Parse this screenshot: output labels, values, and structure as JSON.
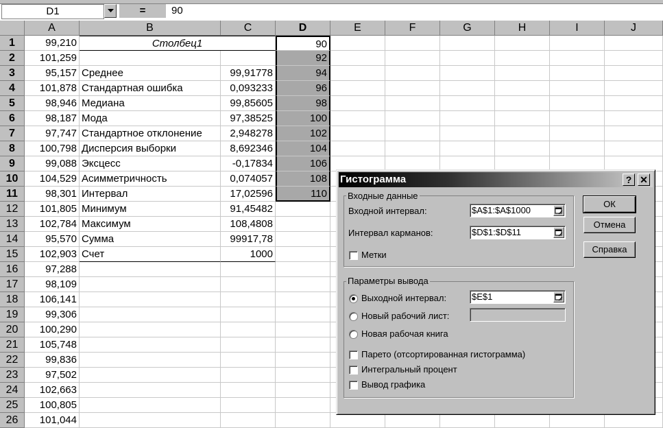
{
  "formula_bar": {
    "name_box": "D1",
    "equals": "=",
    "value": "90"
  },
  "columns": [
    "A",
    "B",
    "C",
    "D",
    "E",
    "F",
    "G",
    "H",
    "I",
    "J"
  ],
  "rows": [
    {
      "n": "1",
      "a": "99,210",
      "b": "Столбец1",
      "c": "",
      "d": "90"
    },
    {
      "n": "2",
      "a": "101,259",
      "b": "",
      "c": "",
      "d": "92"
    },
    {
      "n": "3",
      "a": "95,157",
      "b": "Среднее",
      "c": "99,91778",
      "d": "94"
    },
    {
      "n": "4",
      "a": "101,878",
      "b": "Стандартная ошибка",
      "c": "0,093233",
      "d": "96"
    },
    {
      "n": "5",
      "a": "98,946",
      "b": "Медиана",
      "c": "99,85605",
      "d": "98"
    },
    {
      "n": "6",
      "a": "98,187",
      "b": "Мода",
      "c": "97,38525",
      "d": "100"
    },
    {
      "n": "7",
      "a": "97,747",
      "b": "Стандартное отклонение",
      "c": "2,948278",
      "d": "102"
    },
    {
      "n": "8",
      "a": "100,798",
      "b": "Дисперсия выборки",
      "c": "8,692346",
      "d": "104"
    },
    {
      "n": "9",
      "a": "99,088",
      "b": "Эксцесс",
      "c": "-0,17834",
      "d": "106"
    },
    {
      "n": "10",
      "a": "104,529",
      "b": "Асимметричность",
      "c": "0,074057",
      "d": "108"
    },
    {
      "n": "11",
      "a": "98,301",
      "b": "Интервал",
      "c": "17,02596",
      "d": "110"
    },
    {
      "n": "12",
      "a": "101,805",
      "b": "Минимум",
      "c": "91,45482",
      "d": ""
    },
    {
      "n": "13",
      "a": "102,784",
      "b": "Максимум",
      "c": "108,4808",
      "d": ""
    },
    {
      "n": "14",
      "a": "95,570",
      "b": "Сумма",
      "c": "99917,78",
      "d": ""
    },
    {
      "n": "15",
      "a": "102,903",
      "b": "Счет",
      "c": "1000",
      "d": ""
    },
    {
      "n": "16",
      "a": "97,288",
      "b": "",
      "c": "",
      "d": ""
    },
    {
      "n": "17",
      "a": "98,109",
      "b": "",
      "c": "",
      "d": ""
    },
    {
      "n": "18",
      "a": "106,141",
      "b": "",
      "c": "",
      "d": ""
    },
    {
      "n": "19",
      "a": "99,306",
      "b": "",
      "c": "",
      "d": ""
    },
    {
      "n": "20",
      "a": "100,290",
      "b": "",
      "c": "",
      "d": ""
    },
    {
      "n": "21",
      "a": "105,748",
      "b": "",
      "c": "",
      "d": ""
    },
    {
      "n": "22",
      "a": "99,836",
      "b": "",
      "c": "",
      "d": ""
    },
    {
      "n": "23",
      "a": "97,502",
      "b": "",
      "c": "",
      "d": ""
    },
    {
      "n": "24",
      "a": "102,663",
      "b": "",
      "c": "",
      "d": ""
    },
    {
      "n": "25",
      "a": "100,805",
      "b": "",
      "c": "",
      "d": ""
    },
    {
      "n": "26",
      "a": "101,044",
      "b": "",
      "c": "",
      "d": ""
    }
  ],
  "dialog": {
    "title": "Гистограмма",
    "help_btn": "?",
    "close_btn": "✕",
    "input_group": "Входные данные",
    "input_range_label": "Входной интервал:",
    "input_range_value": "$A$1:$A$1000",
    "bin_range_label": "Интервал карманов:",
    "bin_range_value": "$D$1:$D$11",
    "labels_label": "Метки",
    "output_group": "Параметры вывода",
    "output_range_label": "Выходной интервал:",
    "output_range_value": "$E$1",
    "new_sheet_label": "Новый рабочий лист:",
    "new_book_label": "Новая рабочая книга",
    "pareto_label": "Парето (отсортированная гистограмма)",
    "cumulative_label": "Интегральный процент",
    "chart_label": "Вывод графика",
    "ok": "ОК",
    "cancel": "Отмена",
    "help": "Справка"
  }
}
